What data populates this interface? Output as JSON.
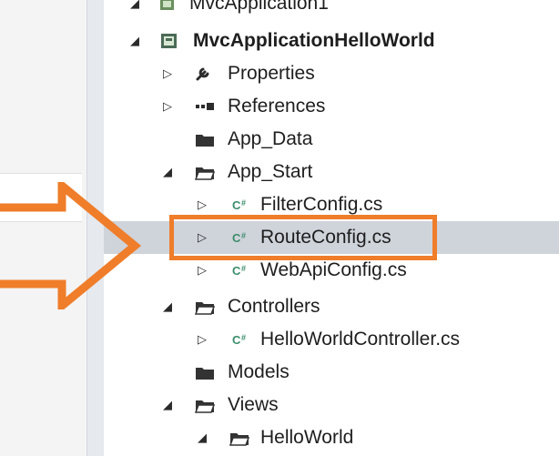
{
  "solution_explorer": {
    "items": [
      {
        "label": "MvcApplication1",
        "depth": 0,
        "expander": "expanded",
        "icon": "project-icon",
        "bold": false
      },
      {
        "label": "MvcApplicationHelloWorld",
        "depth": 0,
        "expander": "expanded",
        "icon": "project-icon",
        "bold": true
      },
      {
        "label": "Properties",
        "depth": 1,
        "expander": "collapsed",
        "icon": "wrench-icon",
        "bold": false
      },
      {
        "label": "References",
        "depth": 1,
        "expander": "collapsed",
        "icon": "references-icon",
        "bold": false
      },
      {
        "label": "App_Data",
        "depth": 1,
        "expander": "none",
        "icon": "folder-icon",
        "bold": false
      },
      {
        "label": "App_Start",
        "depth": 1,
        "expander": "expanded",
        "icon": "folder-open-icon",
        "bold": false
      },
      {
        "label": "FilterConfig.cs",
        "depth": 2,
        "expander": "collapsed",
        "icon": "csharp-file-icon",
        "bold": false
      },
      {
        "label": "RouteConfig.cs",
        "depth": 2,
        "expander": "collapsed",
        "icon": "csharp-file-icon",
        "bold": false,
        "selected": true
      },
      {
        "label": "WebApiConfig.cs",
        "depth": 2,
        "expander": "collapsed",
        "icon": "csharp-file-icon",
        "bold": false
      },
      {
        "label": "Controllers",
        "depth": 1,
        "expander": "expanded",
        "icon": "folder-open-icon",
        "bold": false
      },
      {
        "label": "HelloWorldController.cs",
        "depth": 2,
        "expander": "collapsed",
        "icon": "csharp-file-icon",
        "bold": false
      },
      {
        "label": "Models",
        "depth": 1,
        "expander": "none",
        "icon": "folder-icon",
        "bold": false
      },
      {
        "label": "Views",
        "depth": 1,
        "expander": "expanded",
        "icon": "folder-open-icon",
        "bold": false
      },
      {
        "label": "HelloWorld",
        "depth": 2,
        "expander": "expanded",
        "icon": "folder-open-icon",
        "bold": false
      }
    ],
    "selected_item": "RouteConfig.cs"
  },
  "annotation": {
    "highlight_color": "#ef7d2a",
    "arrow_icon": "arrow-right-icon"
  }
}
